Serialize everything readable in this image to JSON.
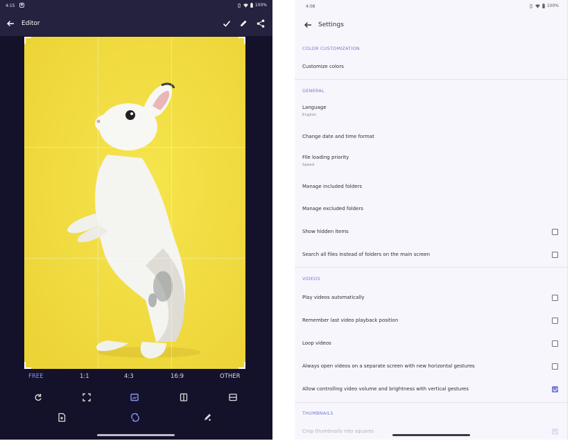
{
  "editor": {
    "status": {
      "time": "4:15",
      "battery": "100%"
    },
    "title": "Editor",
    "ratios": [
      "FREE",
      "1:1",
      "4:3",
      "16:9",
      "OTHER"
    ],
    "selected_ratio": "FREE",
    "tools_row1": [
      "rotate-icon",
      "resize-icon",
      "crop-icon",
      "flip-icon",
      "fit-icon"
    ],
    "tools_row2": [
      "crop-rotate-icon",
      "tune-icon",
      "draw-icon"
    ],
    "photo_colors": {
      "background": "#f2df46",
      "rabbit": "#f5f5f2"
    }
  },
  "settings": {
    "status": {
      "time": "4:08",
      "battery": "100%"
    },
    "title": "Settings",
    "sections": {
      "color": "COLOR CUSTOMIZATION",
      "general": "GENERAL",
      "videos": "VIDEOS",
      "thumbnails": "THUMBNAILS"
    },
    "items": {
      "customize_colors": "Customize colors",
      "language": "Language",
      "language_value": "English",
      "date_format": "Change date and time format",
      "file_priority": "File loading priority",
      "file_priority_value": "Speed",
      "included_folders": "Manage included folders",
      "excluded_folders": "Manage excluded folders",
      "hidden_items": "Show hidden items",
      "search_all": "Search all files instead of folders on the main screen",
      "play_auto": "Play videos automatically",
      "remember_position": "Remember last video playback position",
      "loop": "Loop videos",
      "separate_screen": "Always open videos on a separate screen with new horizontal gestures",
      "vertical_gestures": "Allow controlling video volume and brightness with vertical gestures",
      "crop_thumbnails": "Crop thumbnails into squares"
    },
    "checkboxes": {
      "hidden_items": false,
      "search_all": false,
      "play_auto": false,
      "remember_position": false,
      "loop": false,
      "separate_screen": false,
      "vertical_gestures": true,
      "crop_thumbnails": true
    },
    "accent_color": "#7579c9"
  }
}
